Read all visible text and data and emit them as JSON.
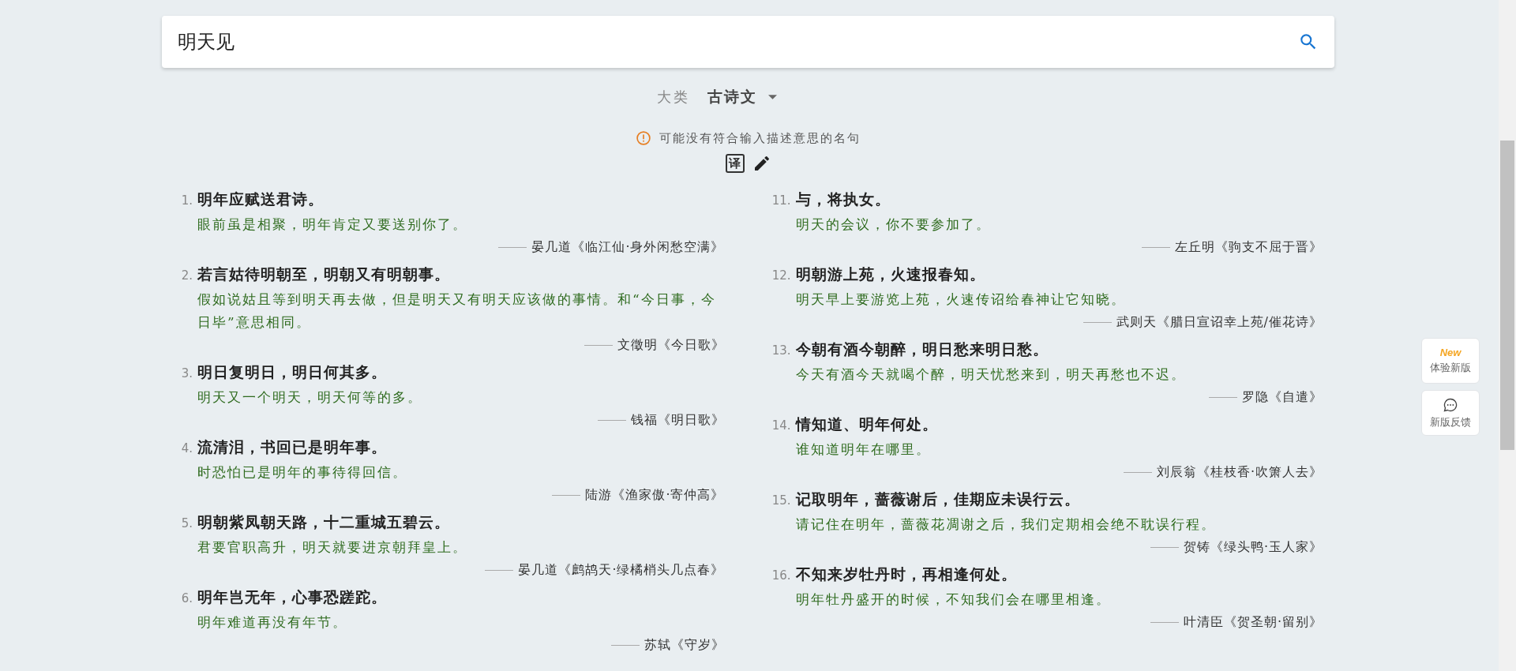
{
  "search": {
    "value": "明天见"
  },
  "category": {
    "label": "大类",
    "value": "古诗文"
  },
  "notice": {
    "text": "可能没有符合输入描述意思的名句"
  },
  "tools": {
    "translate": "译"
  },
  "results": [
    {
      "number": "1.",
      "line": "明年应赋送君诗。",
      "translation": "眼前虽是相聚，明年肯定又要送别你了。",
      "source": "晏几道《临江仙·身外闲愁空满》"
    },
    {
      "number": "2.",
      "line": "若言姑待明朝至，明朝又有明朝事。",
      "translation": "假如说姑且等到明天再去做，但是明天又有明天应该做的事情。和“今日事，今日毕”意思相同。",
      "source": "文徵明《今日歌》"
    },
    {
      "number": "3.",
      "line": "明日复明日，明日何其多。",
      "translation": "明天又一个明天，明天何等的多。",
      "source": "钱福《明日歌》"
    },
    {
      "number": "4.",
      "line": "流清泪，书回已是明年事。",
      "translation": "时恐怕已是明年的事待得回信。",
      "source": "陆游《渔家傲·寄仲高》"
    },
    {
      "number": "5.",
      "line": "明朝紫凤朝天路，十二重城五碧云。",
      "translation": "君要官职高升，明天就要进京朝拜皇上。",
      "source": "晏几道《鹧鸪天·绿橘梢头几点春》"
    },
    {
      "number": "6.",
      "line": "明年岂无年，心事恐蹉跎。",
      "translation": "明年难道再没有年节。",
      "source": "苏轼《守岁》"
    },
    {
      "number": "11.",
      "line": "与，将执女。",
      "translation": "明天的会议，你不要参加了。",
      "source": "左丘明《驹支不屈于晋》"
    },
    {
      "number": "12.",
      "line": "明朝游上苑，火速报春知。",
      "translation": "明天早上要游览上苑，火速传诏给春神让它知晓。",
      "source": "武则天《腊日宣诏幸上苑/催花诗》"
    },
    {
      "number": "13.",
      "line": "今朝有酒今朝醉，明日愁来明日愁。",
      "translation": "今天有酒今天就喝个醉，明天忧愁来到，明天再愁也不迟。",
      "source": "罗隐《自遣》"
    },
    {
      "number": "14.",
      "line": "情知道、明年何处。",
      "translation": "谁知道明年在哪里。",
      "source": "刘辰翁《桂枝香·吹箫人去》"
    },
    {
      "number": "15.",
      "line": "记取明年，蔷薇谢后，佳期应未误行云。",
      "translation": "请记住在明年，蔷薇花凋谢之后，我们定期相会绝不耽误行程。",
      "source": "贺铸《绿头鸭·玉人家》"
    },
    {
      "number": "16.",
      "line": "不知来岁牡丹时，再相逢何处。",
      "translation": "明年牡丹盛开的时候，不知我们会在哪里相逢。",
      "source": "叶清臣《贺圣朝·留别》"
    }
  ],
  "side_buttons": [
    {
      "kind": "new",
      "badge": "New",
      "label": "体验新版"
    },
    {
      "kind": "feedback",
      "label": "新版反馈"
    }
  ]
}
